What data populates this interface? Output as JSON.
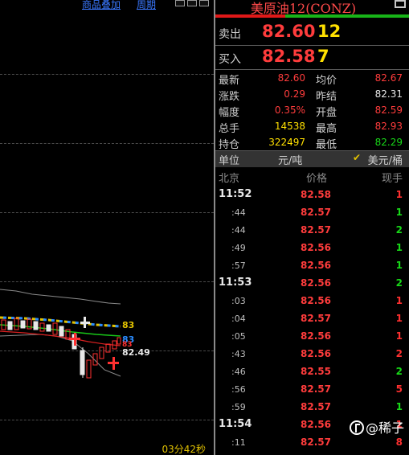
{
  "chart": {
    "links": [
      "商品叠加",
      "周期"
    ],
    "price_labels": [
      "83",
      "83",
      "83",
      "82.49"
    ],
    "time_remaining": "03分42秒",
    "colors": {
      "up": "#ff3030",
      "down": "#18c8c8",
      "ma": "#e2c200"
    }
  },
  "header": {
    "title": "美原油12(CONZ)",
    "ratio": {
      "red": 0.36,
      "green": 0.64
    }
  },
  "orderbook": [
    {
      "label": "卖出",
      "price": "82.60",
      "volume": "12"
    },
    {
      "label": "买入",
      "price": "82.58",
      "volume": "7"
    }
  ],
  "stats": [
    {
      "k1": "最新",
      "v1": "82.60",
      "c1": "#ff3c3c",
      "k2": "均价",
      "v2": "82.67",
      "c2": "#ff3c3c"
    },
    {
      "k1": "涨跌",
      "v1": "0.29",
      "c1": "#ff3c3c",
      "k2": "昨结",
      "v2": "82.31",
      "c2": "#e8e8e8"
    },
    {
      "k1": "幅度",
      "v1": "0.35%",
      "c1": "#ff3c3c",
      "k2": "开盘",
      "v2": "82.59",
      "c2": "#ff3c3c"
    },
    {
      "k1": "总手",
      "v1": "14538",
      "c1": "#ffe000",
      "k2": "最高",
      "v2": "82.93",
      "c2": "#ff3c3c"
    },
    {
      "k1": "持仓",
      "v1": "322497",
      "c1": "#ffe000",
      "k2": "最低",
      "v2": "82.29",
      "c2": "#18d818"
    }
  ],
  "units": {
    "label": "单位",
    "cny": "元/吨",
    "usd": "美元/桶",
    "check_icon": "check-icon"
  },
  "tick_header": {
    "time": "北京",
    "price": "价格",
    "volume": "现手"
  },
  "ticks": [
    {
      "time": "11:52",
      "full": true,
      "price": "82.58",
      "volume": "1",
      "color": "#ff3030"
    },
    {
      "time": ":44",
      "full": false,
      "price": "82.57",
      "volume": "1",
      "color": "#18d818"
    },
    {
      "time": ":44",
      "full": false,
      "price": "82.57",
      "volume": "2",
      "color": "#18d818"
    },
    {
      "time": ":49",
      "full": false,
      "price": "82.56",
      "volume": "1",
      "color": "#18d818"
    },
    {
      "time": ":57",
      "full": false,
      "price": "82.56",
      "volume": "1",
      "color": "#18d818"
    },
    {
      "time": "11:53",
      "full": true,
      "price": "82.56",
      "volume": "2",
      "color": "#18d818"
    },
    {
      "time": ":03",
      "full": false,
      "price": "82.56",
      "volume": "1",
      "color": "#ff3030"
    },
    {
      "time": ":04",
      "full": false,
      "price": "82.57",
      "volume": "1",
      "color": "#ff3030"
    },
    {
      "time": ":05",
      "full": false,
      "price": "82.56",
      "volume": "1",
      "color": "#ff3030"
    },
    {
      "time": ":43",
      "full": false,
      "price": "82.56",
      "volume": "2",
      "color": "#ff3030"
    },
    {
      "time": ":46",
      "full": false,
      "price": "82.55",
      "volume": "2",
      "color": "#18d818"
    },
    {
      "time": ":56",
      "full": false,
      "price": "82.57",
      "volume": "5",
      "color": "#ff3030"
    },
    {
      "time": ":59",
      "full": false,
      "price": "82.57",
      "volume": "1",
      "color": "#18d818"
    },
    {
      "time": "11:54",
      "full": true,
      "price": "82.56",
      "volume": "1",
      "color": "#ff3030"
    },
    {
      "time": ":11",
      "full": false,
      "price": "82.57",
      "volume": "8",
      "color": "#ff3030"
    }
  ],
  "watermark": {
    "text": "@稀子",
    "icon": "fan-icon"
  }
}
